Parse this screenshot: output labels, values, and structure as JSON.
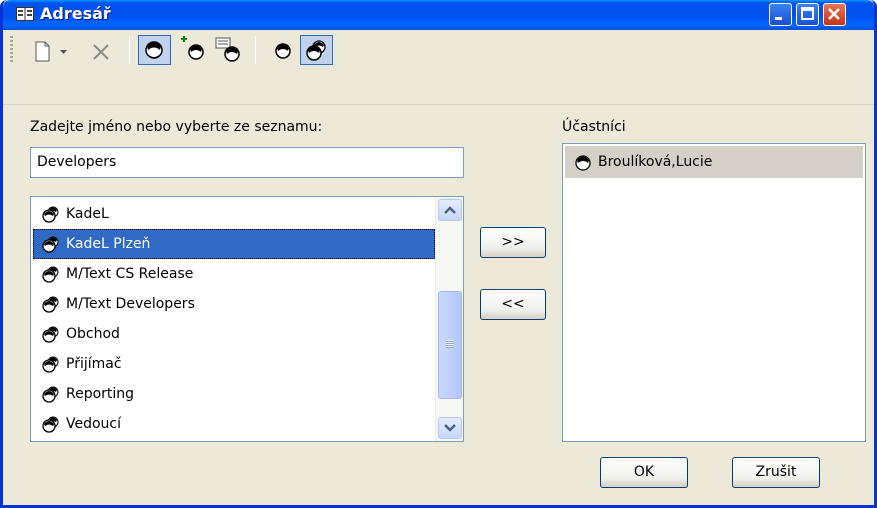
{
  "window": {
    "title": "Adresář"
  },
  "toolbar": {
    "icons": [
      "new-icon",
      "dropdown-arrow-icon",
      "delete-icon",
      "person-icon",
      "person-add-icon",
      "person-properties-icon",
      "person-icon",
      "group-icon"
    ]
  },
  "left": {
    "prompt_label": "Zadejte jméno nebo vyberte ze seznamu:",
    "input_value": "Developers",
    "list_items": [
      "KadeL",
      "KadeL Plzeň",
      "M/Text CS Release",
      "M/Text Developers",
      "Obchod",
      "Přijímač",
      "Reporting",
      "Vedoucí"
    ],
    "selected_item": "KadeL Plzeň"
  },
  "middle": {
    "add_button": ">>",
    "remove_button": "<<"
  },
  "right": {
    "participants_label": "Účastníci",
    "participants": [
      "Broulíková,Lucie"
    ]
  },
  "footer": {
    "ok_button": "OK",
    "cancel_button": "Zrušit"
  },
  "colors": {
    "titlebar": "#0054e3",
    "selection": "#316ac5",
    "face": "#ece9d8"
  }
}
